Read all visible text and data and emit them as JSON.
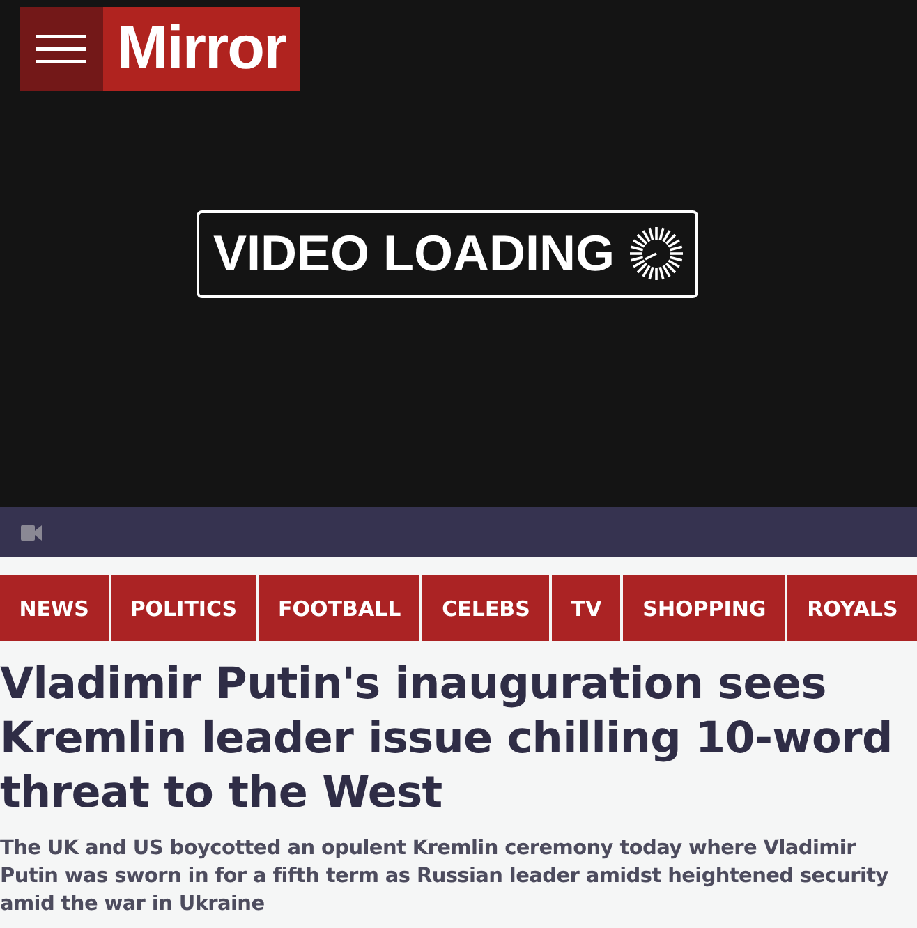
{
  "header": {
    "logo": "Mirror"
  },
  "video": {
    "status": "VIDEO LOADING"
  },
  "nav": {
    "items": [
      {
        "label": "NEWS"
      },
      {
        "label": "POLITICS"
      },
      {
        "label": "FOOTBALL"
      },
      {
        "label": "CELEBS"
      },
      {
        "label": "TV"
      },
      {
        "label": "SHOPPING"
      },
      {
        "label": "ROYALS"
      }
    ]
  },
  "article": {
    "headline": "Vladimir Putin's inauguration sees Kremlin leader issue chilling 10-word threat to the West",
    "standfirst": "The UK and US boycotted an opulent Kremlin ceremony today where Vladimir Putin was sworn in for a fifth term as Russian leader amidst heightened security amid the war in Ukraine"
  }
}
